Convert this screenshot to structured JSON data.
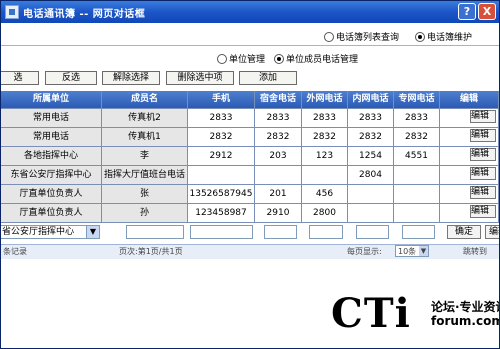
{
  "window": {
    "title": "电话通讯簿 -- 网页对话框",
    "help_label": "?",
    "close_label": "X"
  },
  "top_tabs": [
    {
      "label": "电话簿列表查询",
      "selected": false
    },
    {
      "label": "电话簿维护",
      "selected": true
    }
  ],
  "sub_tabs": [
    {
      "label": "单位管理",
      "selected": false
    },
    {
      "label": "单位成员电话管理",
      "selected": true
    }
  ],
  "toolbar": {
    "select_label": "选",
    "invert_label": "反选",
    "deselect_label": "解除选择",
    "delete_label": "删除选中项",
    "add_label": "添加"
  },
  "table": {
    "columns": [
      "所属单位",
      "成员名",
      "手机",
      "宿舍电话",
      "外网电话",
      "内网电话",
      "专网电话",
      "编辑"
    ],
    "rows": [
      [
        "常用电话",
        "传真机2",
        "2833",
        "2833",
        "2833",
        "2833",
        "2833",
        "编辑"
      ],
      [
        "常用电话",
        "传真机1",
        "2832",
        "2832",
        "2832",
        "2832",
        "2832",
        "编辑"
      ],
      [
        "各地指挥中心",
        "李",
        "2912",
        "203",
        "123",
        "1254",
        "4551",
        "编辑"
      ],
      [
        "东省公安厅指挥中心",
        "指挥大厅值班台电话",
        "",
        "",
        "",
        "2804",
        "",
        "编辑"
      ],
      [
        "厅直单位负责人",
        "张",
        "13526587945",
        "201",
        "456",
        "",
        "",
        "编辑"
      ],
      [
        "厅直单位负责人",
        "孙",
        "123458987",
        "2910",
        "2800",
        "",
        "",
        "编辑"
      ]
    ]
  },
  "new_row": {
    "unit_value": "省公安厅指挥中心",
    "dropdown_glyph": "▼",
    "confirm_label": "确定",
    "edit_label": "编辑"
  },
  "footer": {
    "records_label": "条记录",
    "page_info": "页次:第1页/共1页",
    "per_page_label": "每页显示:",
    "per_page_value": "10条",
    "jump_label": "跳转到"
  },
  "watermark": {
    "brand": "CTi",
    "forum_label": "论坛·专业资讯",
    "url": "forum.com"
  },
  "colors": {
    "titlebar": "#1c55c8",
    "header": "#2a5bb5",
    "close": "#d9503a"
  }
}
